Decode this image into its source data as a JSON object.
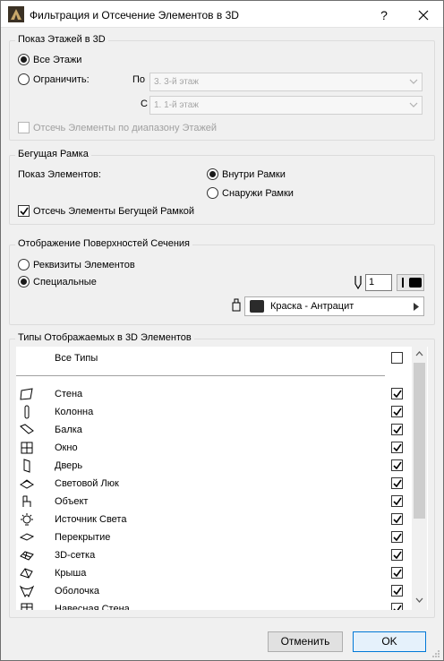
{
  "window": {
    "title": "Фильтрация и Отсечение Элементов в 3D",
    "help_label": "?",
    "close_label": "✕"
  },
  "floors": {
    "title": "Показ Этажей в 3D",
    "all_label": "Все Этажи",
    "all_selected": true,
    "limit_label": "Ограничить:",
    "limit_selected": false,
    "to_label": "По",
    "to_value": "3. 3-й этаж",
    "from_label": "С",
    "from_value": "1. 1-й этаж",
    "cut_label": "Отсечь Элементы по диапазону Этажей",
    "cut_checked": false
  },
  "marquee": {
    "title": "Бегущая Рамка",
    "show_label": "Показ Элементов:",
    "inside_label": "Внутри Рамки",
    "inside_selected": true,
    "outside_label": "Снаружи Рамки",
    "outside_selected": false,
    "cut_label": "Отсечь Элементы Бегущей Рамкой",
    "cut_checked": true
  },
  "cut_surfaces": {
    "title": "Отображение Поверхностей Сечения",
    "attrs_label": "Реквизиты Элементов",
    "attrs_selected": false,
    "custom_label": "Специальные",
    "custom_selected": true,
    "pen_value": "1",
    "paint_label": "Краска - Антрацит",
    "paint_color": "#2b2b2b"
  },
  "types": {
    "title": "Типы Отображаемых в 3D Элементов",
    "all_label": "Все Типы",
    "all_checked": false,
    "items": [
      {
        "label": "Стена",
        "icon": "wall-icon",
        "checked": true
      },
      {
        "label": "Колонна",
        "icon": "column-icon",
        "checked": true
      },
      {
        "label": "Балка",
        "icon": "beam-icon",
        "checked": true
      },
      {
        "label": "Окно",
        "icon": "window-icon",
        "checked": true
      },
      {
        "label": "Дверь",
        "icon": "door-icon",
        "checked": true
      },
      {
        "label": "Световой Люк",
        "icon": "skylight-icon",
        "checked": true
      },
      {
        "label": "Объект",
        "icon": "object-icon",
        "checked": true
      },
      {
        "label": "Источник Света",
        "icon": "lamp-icon",
        "checked": true
      },
      {
        "label": "Перекрытие",
        "icon": "slab-icon",
        "checked": true
      },
      {
        "label": "3D-сетка",
        "icon": "mesh-icon",
        "checked": true
      },
      {
        "label": "Крыша",
        "icon": "roof-icon",
        "checked": true
      },
      {
        "label": "Оболочка",
        "icon": "shell-icon",
        "checked": true
      },
      {
        "label": "Навесная Стена",
        "icon": "curtain-wall-icon",
        "checked": true
      }
    ]
  },
  "buttons": {
    "cancel_label": "Отменить",
    "ok_label": "OK"
  }
}
